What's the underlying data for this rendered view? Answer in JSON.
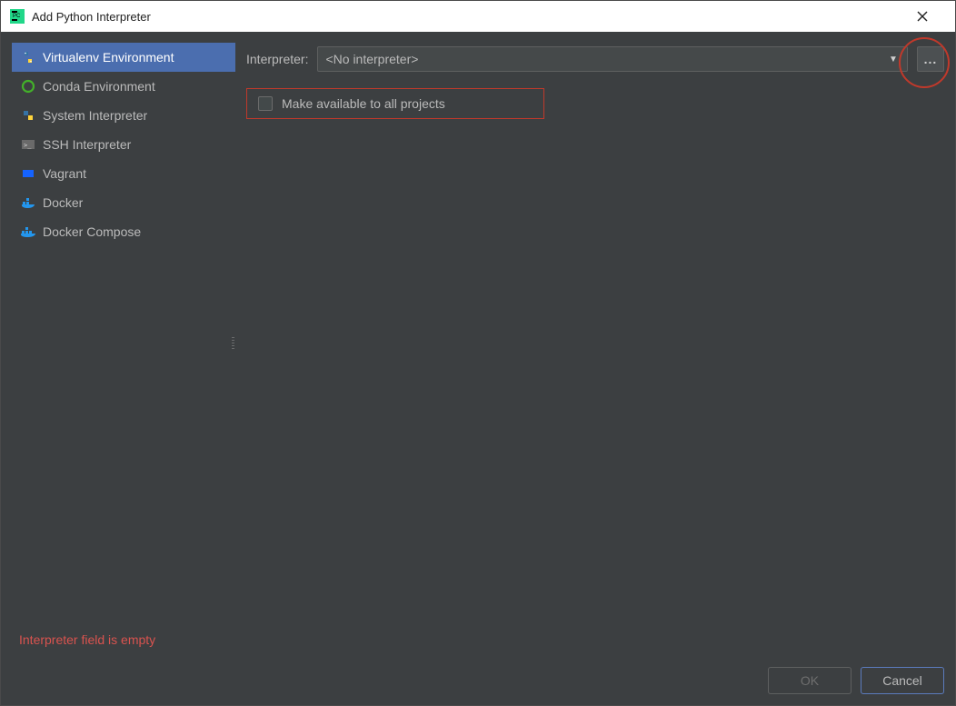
{
  "window": {
    "title": "Add Python Interpreter"
  },
  "sidebar": {
    "items": [
      {
        "label": "Virtualenv Environment",
        "icon": "python-venv-icon",
        "selected": true
      },
      {
        "label": "Conda Environment",
        "icon": "conda-icon",
        "selected": false
      },
      {
        "label": "System Interpreter",
        "icon": "python-icon",
        "selected": false
      },
      {
        "label": "SSH Interpreter",
        "icon": "terminal-icon",
        "selected": false
      },
      {
        "label": "Vagrant",
        "icon": "vagrant-icon",
        "selected": false
      },
      {
        "label": "Docker",
        "icon": "docker-icon",
        "selected": false
      },
      {
        "label": "Docker Compose",
        "icon": "docker-compose-icon",
        "selected": false
      }
    ]
  },
  "content": {
    "interpreter_label": "Interpreter:",
    "interpreter_value": "<No interpreter>",
    "browse_label": "...",
    "checkbox_label": "Make available to all projects",
    "checkbox_checked": false
  },
  "footer": {
    "error_text": "Interpreter field is empty",
    "ok_label": "OK",
    "cancel_label": "Cancel",
    "ok_enabled": false
  },
  "annotations": {
    "browse_highlight_color": "#c0392b",
    "checkbox_outline_color": "#c0392b"
  }
}
